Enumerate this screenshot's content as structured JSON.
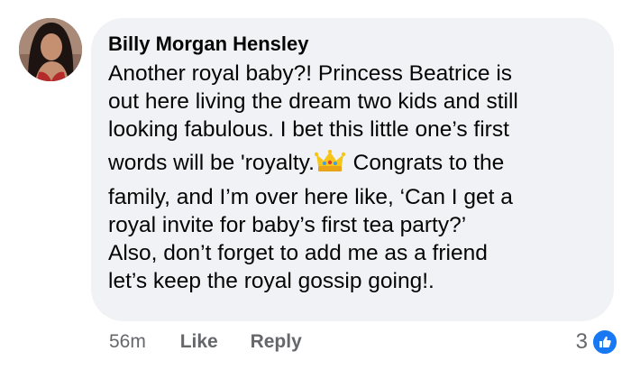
{
  "comment": {
    "author": "Billy Morgan Hensley",
    "lines": [
      "Another royal baby?! Princess Beatrice is",
      "out here living the dream two kids and still",
      "looking fabulous. I bet this little one’s first",
      "words will be 'royalty.",
      " Congrats to the",
      "family, and I’m over here like, ‘Can I get a",
      "royal invite for baby’s first tea party?’",
      "Also, don’t forget to add me as a friend",
      "let’s keep the royal gossip going!."
    ],
    "emoji": "crown-emoji"
  },
  "actions": {
    "time": "56m",
    "like_label": "Like",
    "reply_label": "Reply"
  },
  "reactions": {
    "count": "3",
    "icon": "like-icon"
  },
  "colors": {
    "bubble": "#f0f2f5",
    "text": "#050505",
    "meta": "#65676b",
    "like_blue": "#1877f2"
  }
}
